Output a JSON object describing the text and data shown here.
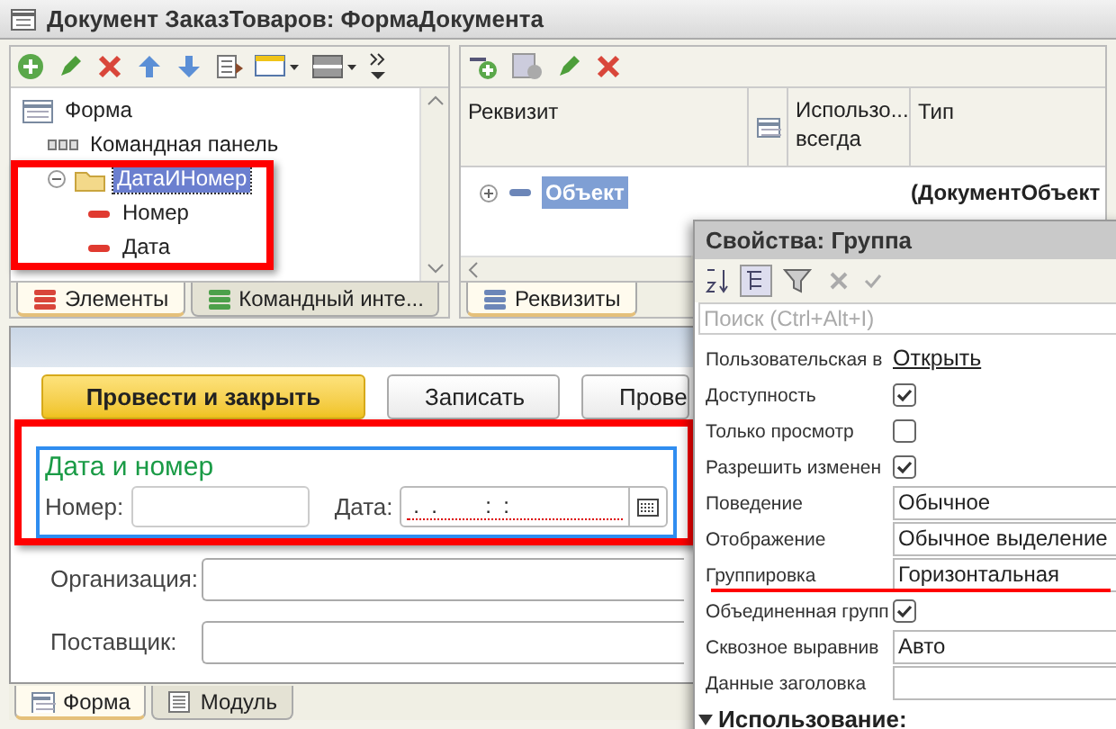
{
  "window": {
    "title": "Документ ЗаказТоваров: ФормаДокумента"
  },
  "elements_panel": {
    "tree": [
      {
        "label": "Форма",
        "kind": "form",
        "selected": false,
        "children": [
          {
            "label": "Командная панель",
            "kind": "command_bar",
            "selected": false
          },
          {
            "label": "ДатаИНомер",
            "kind": "group",
            "selected": true,
            "expanded": true,
            "children": [
              {
                "label": "Номер",
                "kind": "field",
                "selected": false
              },
              {
                "label": "Дата",
                "kind": "field",
                "selected": false
              }
            ]
          }
        ]
      }
    ],
    "tabs": [
      {
        "label": "Элементы",
        "selected": true
      },
      {
        "label": "Командный инте...",
        "selected": false
      }
    ]
  },
  "attributes_panel": {
    "columns": [
      "Реквизит",
      "Использо... всегда",
      "Тип"
    ],
    "rows": [
      {
        "name": "Объект",
        "type": "(ДокументОбъект",
        "selected": true,
        "expanded": false
      }
    ],
    "tabs": [
      {
        "label": "Реквизиты",
        "selected": true
      }
    ]
  },
  "form_preview": {
    "buttons": [
      {
        "label": "Провести и закрыть",
        "default": true
      },
      {
        "label": "Записать",
        "default": false
      },
      {
        "label": "Прове",
        "default": false
      }
    ],
    "group": {
      "title": "Дата и номер",
      "fields": [
        {
          "label": "Номер:",
          "kind": "text"
        },
        {
          "label": "Дата:",
          "kind": "date",
          "value": " .  .        :  :"
        }
      ]
    },
    "fields": [
      {
        "label": "Организация:"
      },
      {
        "label": "Поставщик:"
      }
    ],
    "tabs": [
      {
        "label": "Форма",
        "selected": true
      },
      {
        "label": "Модуль",
        "selected": false
      }
    ]
  },
  "properties": {
    "title": "Свойства: Группа",
    "search": {
      "placeholder": "Поиск (Ctrl+Alt+I)"
    },
    "rows": [
      {
        "name": "Пользовательская в",
        "kind": "link",
        "value": "Открыть"
      },
      {
        "name": "Доступность",
        "kind": "checkbox",
        "checked": true
      },
      {
        "name": "Только просмотр",
        "kind": "checkbox",
        "checked": false
      },
      {
        "name": "Разрешить изменен",
        "kind": "checkbox",
        "checked": true
      },
      {
        "name": "Поведение",
        "kind": "text",
        "value": "Обычное"
      },
      {
        "name": "Отображение",
        "kind": "text",
        "value": "Обычное выделение"
      },
      {
        "name": "Группировка",
        "kind": "text",
        "value": "Горизонтальная"
      },
      {
        "name": "Объединенная групп",
        "kind": "checkbox",
        "checked": true
      },
      {
        "name": "Сквозное выравнив",
        "kind": "text",
        "value": "Авто"
      },
      {
        "name": "Данные заголовка",
        "kind": "text",
        "value": ""
      }
    ],
    "section": {
      "label": "Использование:",
      "expanded": true
    }
  }
}
